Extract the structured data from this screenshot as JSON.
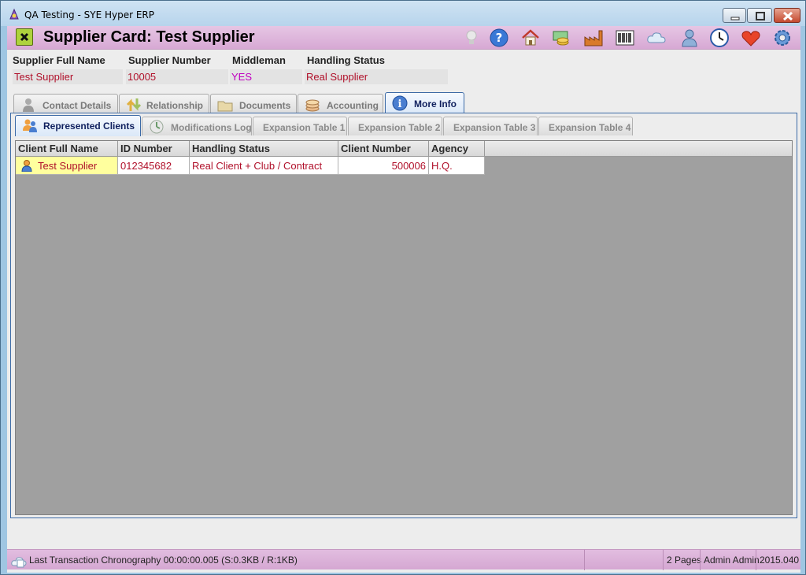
{
  "window": {
    "title": "QA Testing - SYE Hyper ERP"
  },
  "header": {
    "title": "Supplier Card:  Test Supplier",
    "toolbar_icons": [
      "lightbulb-icon",
      "help-icon",
      "home-icon",
      "money-icon",
      "factory-icon",
      "barcode-icon",
      "cloud-icon",
      "users-icon",
      "clock-icon",
      "heart-icon",
      "gear-icon"
    ]
  },
  "fields": {
    "supplier_full_name": {
      "label": "Supplier Full Name",
      "value": "Test Supplier"
    },
    "supplier_number": {
      "label": "Supplier Number",
      "value": "10005"
    },
    "middleman": {
      "label": "Middleman",
      "value": "YES"
    },
    "handling_status": {
      "label": "Handling Status",
      "value": "Real Supplier"
    }
  },
  "tabs": [
    {
      "label": "Contact Details"
    },
    {
      "label": "Relationship"
    },
    {
      "label": "Documents"
    },
    {
      "label": "Accounting"
    },
    {
      "label": "More Info"
    }
  ],
  "sub_tabs": [
    {
      "label": "Represented Clients"
    },
    {
      "label": "Modifications Log"
    },
    {
      "label": "Expansion Table 1"
    },
    {
      "label": "Expansion Table 2"
    },
    {
      "label": "Expansion Table 3"
    },
    {
      "label": "Expansion Table 4"
    }
  ],
  "table": {
    "columns": [
      "Client Full Name",
      "ID Number",
      "Handling Status",
      "Client Number",
      "Agency"
    ],
    "rows": [
      [
        "Test Supplier",
        "012345682",
        "Real Client + Club / Contract",
        "500006",
        "H.Q."
      ]
    ]
  },
  "statusbar": {
    "info": "Last Transaction Chronography  00:00:00.005   (S:0.3KB / R:1KB)",
    "pages": "2 Pages",
    "user": "Admin Admin",
    "version": "2015.040"
  },
  "colors": {
    "accent": "#d7a9d4",
    "value_text": "#b0102a",
    "middleman_text": "#c000c0",
    "grid_bg": "#a0a0a0",
    "first_cell_bg": "#ffff9e"
  }
}
